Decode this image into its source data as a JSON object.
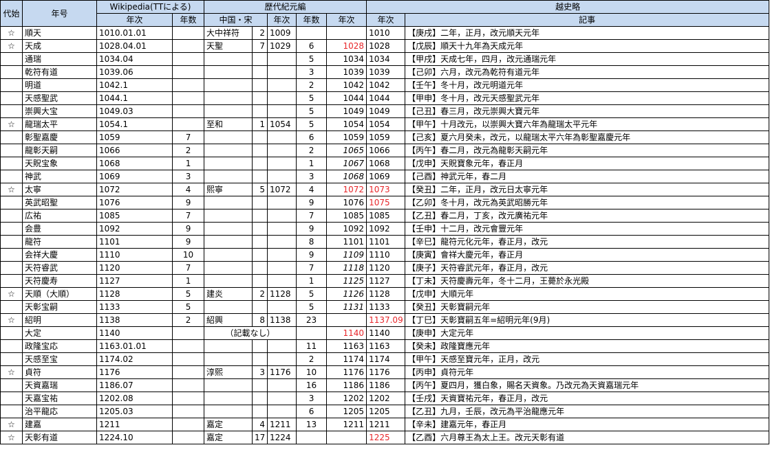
{
  "headers": {
    "dai_shi": "代始",
    "nengo": "年号",
    "wikipedia": "Wikipedia(TTによる)",
    "rekidai": "歴代紀元編",
    "etsushiryaku": "越史略",
    "nenji": "年次",
    "nensu": "年数",
    "chugoku_sou": "中国・宋",
    "nenji2": "年次",
    "nensu2": "年数",
    "nenji3": "年次",
    "nenji4": "年次",
    "kiji": "記事"
  },
  "colors": {
    "header_bg": "#c6d9f0",
    "highlight_red": "#e8262a"
  },
  "rows": [
    {
      "star": "☆",
      "nengo": "順天",
      "wiki_year": "1010.01.01",
      "wiki_count": "",
      "song_name": "大中祥符",
      "song_n": "2",
      "song_year": "1009",
      "rk_count": "",
      "rk_year": "",
      "es_year": "1010",
      "kiji": "【庚戌】二年，正月，改元順天元年"
    },
    {
      "star": "☆",
      "nengo": "天成",
      "wiki_year": "1028.04.01",
      "wiki_count": "",
      "song_name": "天聖",
      "song_n": "7",
      "song_year": "1029",
      "rk_count": "6",
      "rk_year": "1028",
      "rk_year_red": true,
      "es_year": "1028",
      "kiji": "【戊辰】順天十九年為天成元年"
    },
    {
      "star": "",
      "nengo": "通瑞",
      "wiki_year": "1034.04",
      "wiki_count": "",
      "song_name": "",
      "song_n": "",
      "song_year": "",
      "rk_count": "5",
      "rk_year": "1034",
      "es_year": "1034",
      "kiji": "【甲戌】天成七年，四月，改元通瑞元年"
    },
    {
      "star": "",
      "nengo": "乾符有道",
      "wiki_year": "1039.06",
      "wiki_count": "",
      "song_name": "",
      "song_n": "",
      "song_year": "",
      "rk_count": "3",
      "rk_year": "1039",
      "es_year": "1039",
      "kiji": "【己卯】六月，改元為乾符有道元年"
    },
    {
      "star": "",
      "nengo": "明道",
      "wiki_year": "1042.1",
      "wiki_count": "",
      "song_name": "",
      "song_n": "",
      "song_year": "",
      "rk_count": "2",
      "rk_year": "1042",
      "es_year": "1042",
      "kiji": "【壬午】冬十月，改元明道元年"
    },
    {
      "star": "",
      "nengo": "天感聖武",
      "wiki_year": "1044.1",
      "wiki_count": "",
      "song_name": "",
      "song_n": "",
      "song_year": "",
      "rk_count": "5",
      "rk_year": "1044",
      "es_year": "1044",
      "kiji": "【甲申】冬十月，改元天感聖武元年"
    },
    {
      "star": "",
      "nengo": "崇興大宝",
      "wiki_year": "1049.03",
      "wiki_count": "",
      "song_name": "",
      "song_n": "",
      "song_year": "",
      "rk_count": "5",
      "rk_year": "1049",
      "es_year": "1049",
      "kiji": "【己丑】春三月，改元崇興大寶元年"
    },
    {
      "star": "☆",
      "nengo": "龍瑞太平",
      "wiki_year": "1054.1",
      "wiki_count": "",
      "song_name": "至和",
      "song_n": "1",
      "song_year": "1054",
      "rk_count": "5",
      "rk_year": "1054",
      "es_year": "1054",
      "kiji": "【甲午】十月改元，以崇興大寶六年為龍瑞太平元年"
    },
    {
      "star": "",
      "nengo": "彰聖嘉慶",
      "wiki_year": "1059",
      "wiki_count": "7",
      "song_name": "",
      "song_n": "",
      "song_year": "",
      "rk_count": "6",
      "rk_year": "1059",
      "es_year": "1059",
      "kiji": "【己亥】夏六月癸未，改元，以龍瑞太平六年為彰聖嘉慶元年"
    },
    {
      "star": "",
      "nengo": "龍彰天嗣",
      "wiki_year": "1066",
      "wiki_count": "2",
      "song_name": "",
      "song_n": "",
      "song_year": "",
      "rk_count": "2",
      "rk_year": "1065",
      "rk_year_italic": true,
      "es_year": "1066",
      "kiji": "【丙午】春二月，改元為龍彰天嗣元年"
    },
    {
      "star": "",
      "nengo": "天貺宝象",
      "wiki_year": "1068",
      "wiki_count": "1",
      "song_name": "",
      "song_n": "",
      "song_year": "",
      "rk_count": "1",
      "rk_year": "1067",
      "rk_year_italic": true,
      "es_year": "1068",
      "kiji": "【戊申】天貺寶象元年，春正月"
    },
    {
      "star": "",
      "nengo": "神武",
      "wiki_year": "1069",
      "wiki_count": "3",
      "song_name": "",
      "song_n": "",
      "song_year": "",
      "rk_count": "3",
      "rk_year": "1068",
      "rk_year_italic": true,
      "es_year": "1069",
      "kiji": "【己酉】神武元年，春二月"
    },
    {
      "star": "☆",
      "nengo": "太寧",
      "wiki_year": "1072",
      "wiki_count": "4",
      "song_name": "熙寧",
      "song_n": "5",
      "song_year": "1072",
      "rk_count": "4",
      "rk_year": "1072",
      "rk_year_red": true,
      "es_year": "1073",
      "es_year_red_bold": true,
      "kiji": "【癸丑】二年，正月，改元日太寧元年"
    },
    {
      "star": "",
      "nengo": "英武昭聖",
      "wiki_year": "1076",
      "wiki_count": "9",
      "song_name": "",
      "song_n": "",
      "song_year": "",
      "rk_count": "9",
      "rk_year": "1076",
      "es_year": "1075",
      "es_year_red_bold": true,
      "kiji": "【乙卯】冬十月，改元為英武昭勝元年"
    },
    {
      "star": "",
      "nengo": "広祐",
      "wiki_year": "1085",
      "wiki_count": "7",
      "song_name": "",
      "song_n": "",
      "song_year": "",
      "rk_count": "7",
      "rk_year": "1085",
      "es_year": "1085",
      "kiji": "【乙丑】春二月，丁亥，改元廣祐元年"
    },
    {
      "star": "",
      "nengo": "会豊",
      "wiki_year": "1092",
      "wiki_count": "9",
      "song_name": "",
      "song_n": "",
      "song_year": "",
      "rk_count": "9",
      "rk_year": "1092",
      "es_year": "1092",
      "kiji": "【壬申】十二月，改元會豐元年"
    },
    {
      "star": "",
      "nengo": "龍符",
      "wiki_year": "1101",
      "wiki_count": "9",
      "song_name": "",
      "song_n": "",
      "song_year": "",
      "rk_count": "8",
      "rk_year": "1101",
      "es_year": "1101",
      "kiji": "【辛巳】龍符元化元年，春正月，改元"
    },
    {
      "star": "",
      "nengo": "会祥大慶",
      "wiki_year": "1110",
      "wiki_count": "10",
      "song_name": "",
      "song_n": "",
      "song_year": "",
      "rk_count": "9",
      "rk_year": "1109",
      "rk_year_italic": true,
      "es_year": "1110",
      "kiji": "【庚寅】會祥大慶元年，春正月"
    },
    {
      "star": "",
      "nengo": "天符睿武",
      "wiki_year": "1120",
      "wiki_count": "7",
      "song_name": "",
      "song_n": "",
      "song_year": "",
      "rk_count": "7",
      "rk_year": "1118",
      "rk_year_italic": true,
      "es_year": "1120",
      "kiji": "【庚子】天符睿武元年，春正月，改元"
    },
    {
      "star": "",
      "nengo": "天符慶寿",
      "wiki_year": "1127",
      "wiki_count": "1",
      "song_name": "",
      "song_n": "",
      "song_year": "",
      "rk_count": "1",
      "rk_year": "1125",
      "rk_year_italic": true,
      "es_year": "1127",
      "kiji": "【丁未】天符慶壽元年，冬十二月，王薨於永光殿"
    },
    {
      "star": "☆",
      "nengo": "天順（大順）",
      "wiki_year": "1128",
      "wiki_count": "5",
      "song_name": "建炎",
      "song_n": "2",
      "song_year": "1128",
      "rk_count": "5",
      "rk_year": "1126",
      "rk_year_italic": true,
      "es_year": "1128",
      "kiji": "【戊申】大順元年"
    },
    {
      "star": "",
      "nengo": "天彰宝嗣",
      "wiki_year": "1133",
      "wiki_count": "5",
      "song_name": "",
      "song_n": "",
      "song_year": "",
      "rk_count": "5",
      "rk_year": "1131",
      "rk_year_italic": true,
      "es_year": "1133",
      "kiji": "【癸丑】天彰寶嗣元年"
    },
    {
      "star": "☆",
      "nengo": "紹明",
      "wiki_year": "1138",
      "wiki_count": "2",
      "song_name": "紹興",
      "song_n": "8",
      "song_year": "1138",
      "rk_count": "23",
      "rk_year": "",
      "es_year": "1137.09",
      "es_year_red_bold": true,
      "kiji": "【丁巳】天彰寶嗣五年=紹明元年(9月)"
    },
    {
      "star": "",
      "nengo": "大定",
      "wiki_year": "1140",
      "wiki_count": "",
      "note": "（記載なし）",
      "rk_count": "",
      "rk_year": "1140",
      "rk_year_red": true,
      "es_year": "1140",
      "kiji": "【庚申】大定元年"
    },
    {
      "star": "",
      "nengo": "政隆宝応",
      "wiki_year": "1163.01.01",
      "wiki_count": "",
      "song_name": "",
      "song_n": "",
      "song_year": "",
      "rk_count": "11",
      "rk_year": "1163",
      "es_year": "1163",
      "kiji": "【癸未】政隆寶應元年"
    },
    {
      "star": "",
      "nengo": "天感至宝",
      "wiki_year": "1174.02",
      "wiki_count": "",
      "song_name": "",
      "song_n": "",
      "song_year": "",
      "rk_count": "2",
      "rk_year": "1174",
      "es_year": "1174",
      "kiji": "【甲午】天感至寶元年，正月，改元"
    },
    {
      "star": "☆",
      "nengo": "貞符",
      "wiki_year": "1176",
      "wiki_count": "",
      "song_name": "淳熙",
      "song_n": "3",
      "song_year": "1176",
      "rk_count": "10",
      "rk_year": "1176",
      "es_year": "1176",
      "kiji": "【丙申】貞符元年"
    },
    {
      "star": "",
      "nengo": "天資嘉瑞",
      "wiki_year": "1186.07",
      "wiki_count": "",
      "song_name": "",
      "song_n": "",
      "song_year": "",
      "rk_count": "16",
      "rk_year": "1186",
      "es_year": "1186",
      "kiji": "【丙午】夏四月，獲白象，賜名天資象。乃改元為天資嘉瑞元年"
    },
    {
      "star": "",
      "nengo": "天嘉宝祐",
      "wiki_year": "1202.08",
      "wiki_count": "",
      "song_name": "",
      "song_n": "",
      "song_year": "",
      "rk_count": "3",
      "rk_year": "1202",
      "es_year": "1202",
      "kiji": "【壬戌】天資寶祐元年，春正月，改元"
    },
    {
      "star": "",
      "nengo": "治平龍応",
      "wiki_year": "1205.03",
      "wiki_count": "",
      "song_name": "",
      "song_n": "",
      "song_year": "",
      "rk_count": "6",
      "rk_year": "1205",
      "es_year": "1205",
      "kiji": "【乙丑】九月，壬辰，改元為平治龍應元年"
    },
    {
      "star": "☆",
      "nengo": "建嘉",
      "wiki_year": "1211",
      "wiki_count": "",
      "song_name": "嘉定",
      "song_n": "4",
      "song_year": "1211",
      "rk_count": "13",
      "rk_year": "1211",
      "es_year": "1211",
      "kiji": "【辛未】建嘉元年，春正月"
    },
    {
      "star": "☆",
      "nengo": "天彰有道",
      "wiki_year": "1224.10",
      "wiki_count": "",
      "song_name": "嘉定",
      "song_n": "17",
      "song_year": "1224",
      "rk_count": "",
      "rk_year": "",
      "es_year": "1225",
      "es_year_red_bold": true,
      "kiji": "【乙酉】六月尊王為太上王。改元天彰有道"
    }
  ]
}
